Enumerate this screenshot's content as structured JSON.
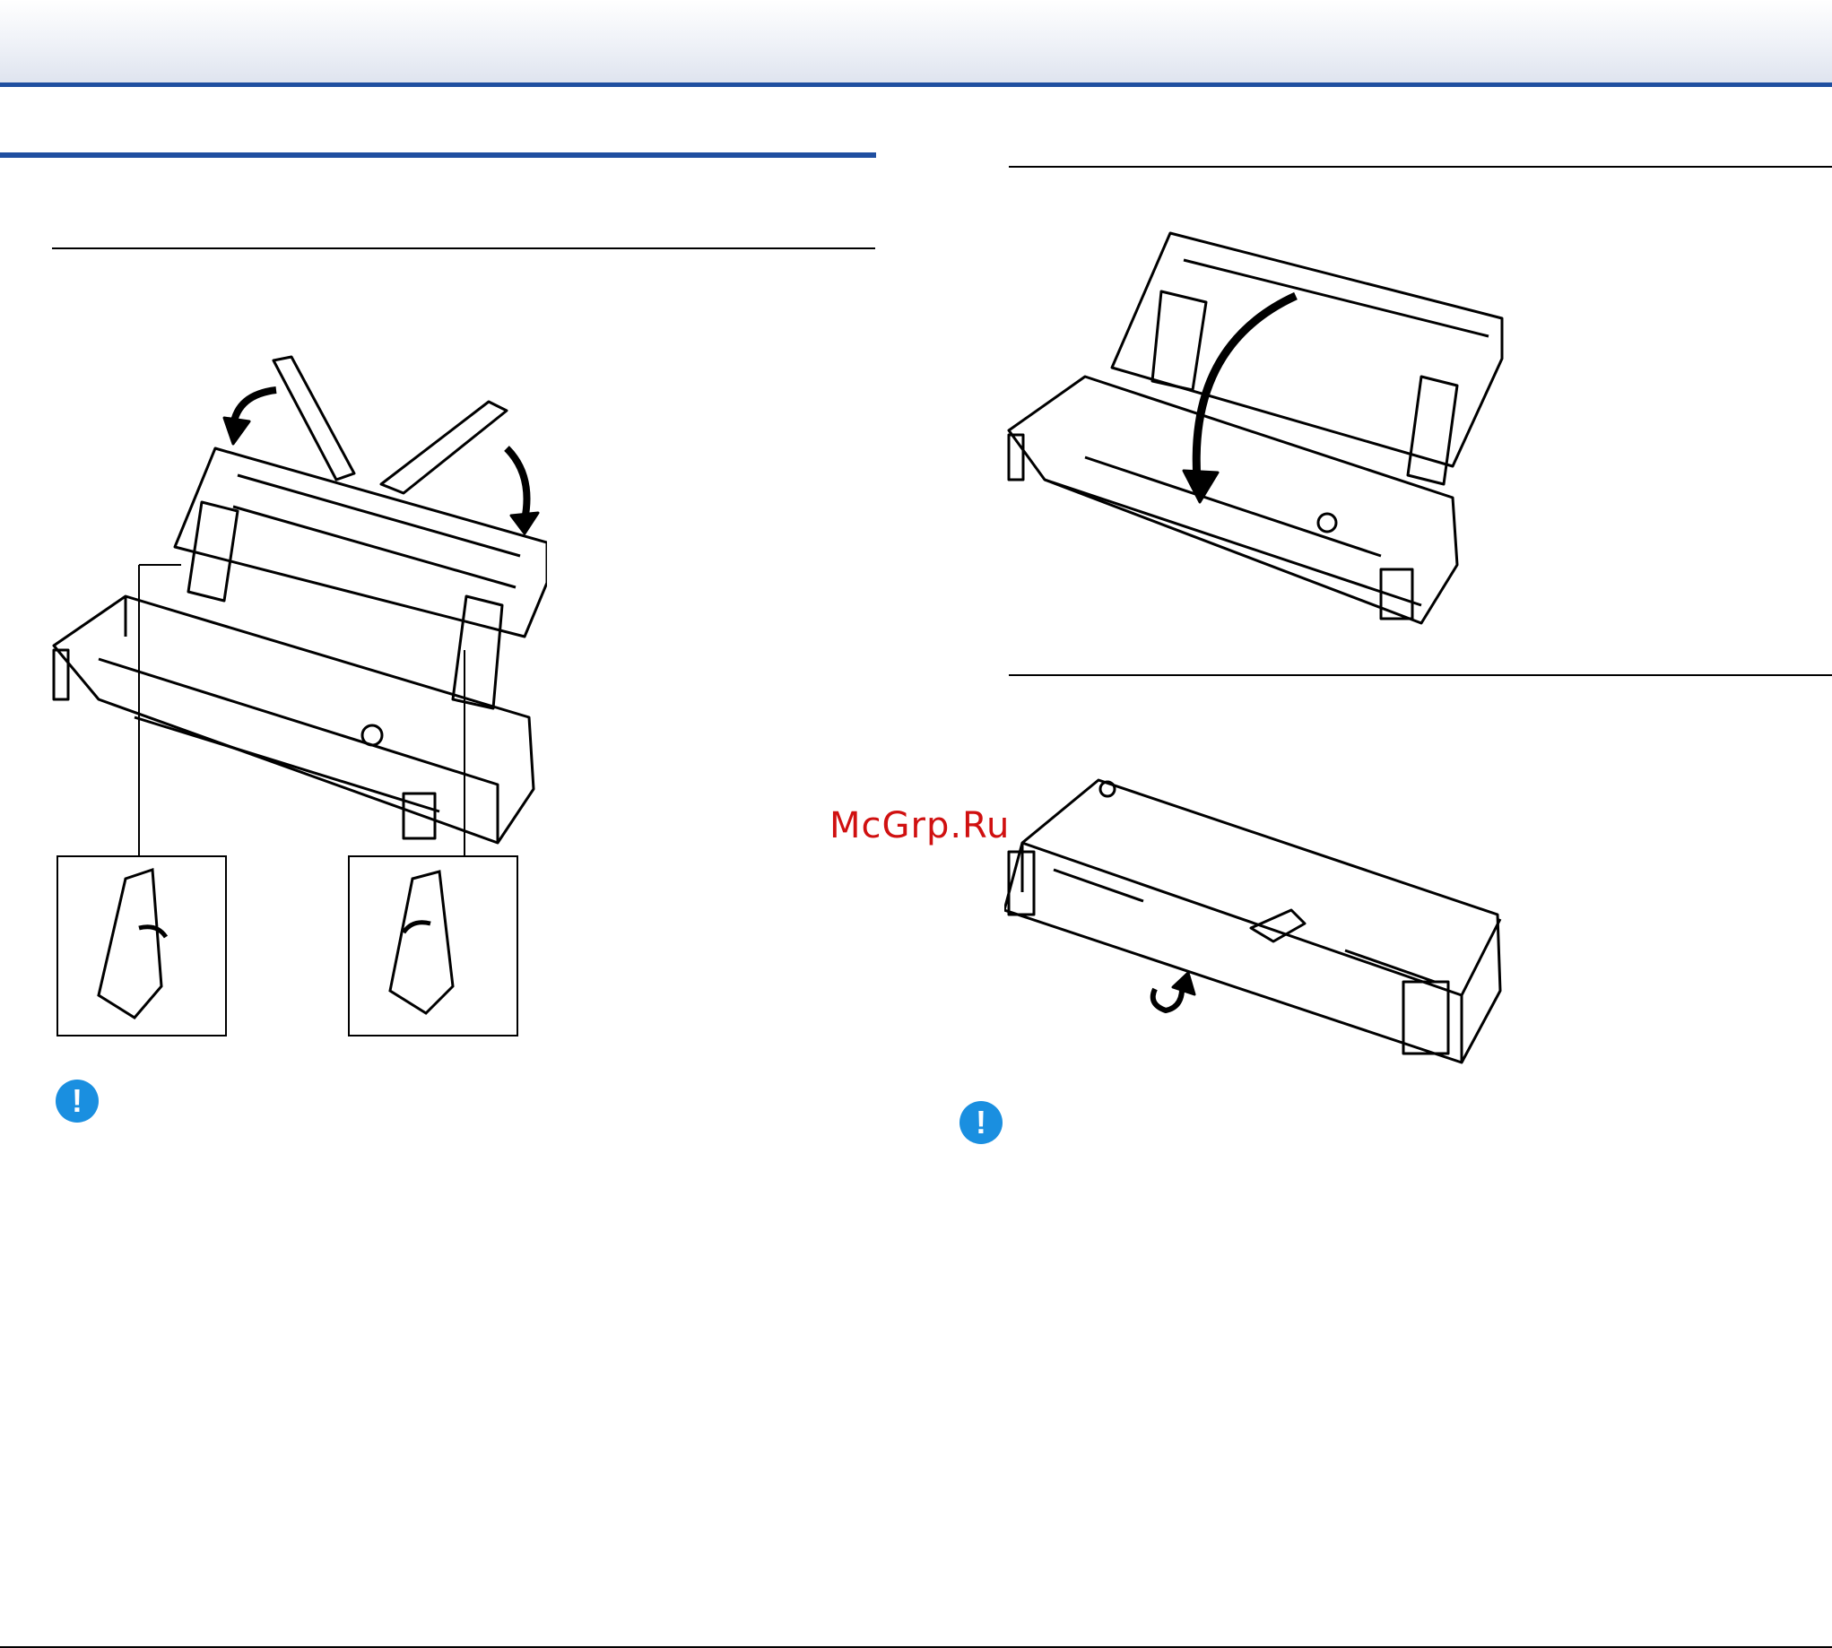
{
  "watermark": "McGrp.Ru",
  "colors": {
    "header_rule": "#1f4fa0",
    "important_icon": "#1a8fe0",
    "watermark": "#d01010"
  },
  "important_icon_glyph": "!",
  "figures": [
    {
      "name": "scanner-open-guides",
      "callout_count": 2
    },
    {
      "name": "scanner-close-cover"
    },
    {
      "name": "scanner-closed-carry"
    }
  ]
}
